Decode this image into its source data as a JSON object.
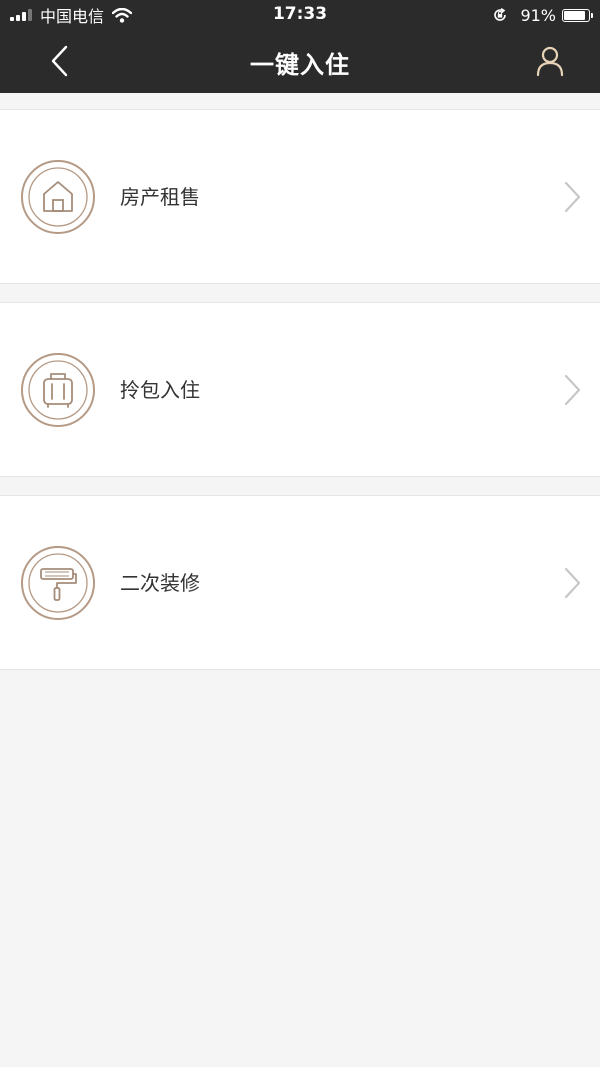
{
  "status_bar": {
    "carrier": "中国电信",
    "time": "17:33",
    "battery_percent": "91%",
    "battery_level": 0.91
  },
  "nav": {
    "title": "一键入住",
    "back_icon": "back-chevron-icon",
    "user_icon": "user-icon"
  },
  "menu": {
    "items": [
      {
        "label": "房产租售",
        "icon": "house-icon"
      },
      {
        "label": "拎包入住",
        "icon": "luggage-icon"
      },
      {
        "label": "二次装修",
        "icon": "paint-roller-icon"
      }
    ]
  },
  "colors": {
    "header_bg": "#2b2b2b",
    "accent": "#b59a85",
    "page_bg": "#f5f5f5",
    "chevron": "#c7c7c7"
  }
}
